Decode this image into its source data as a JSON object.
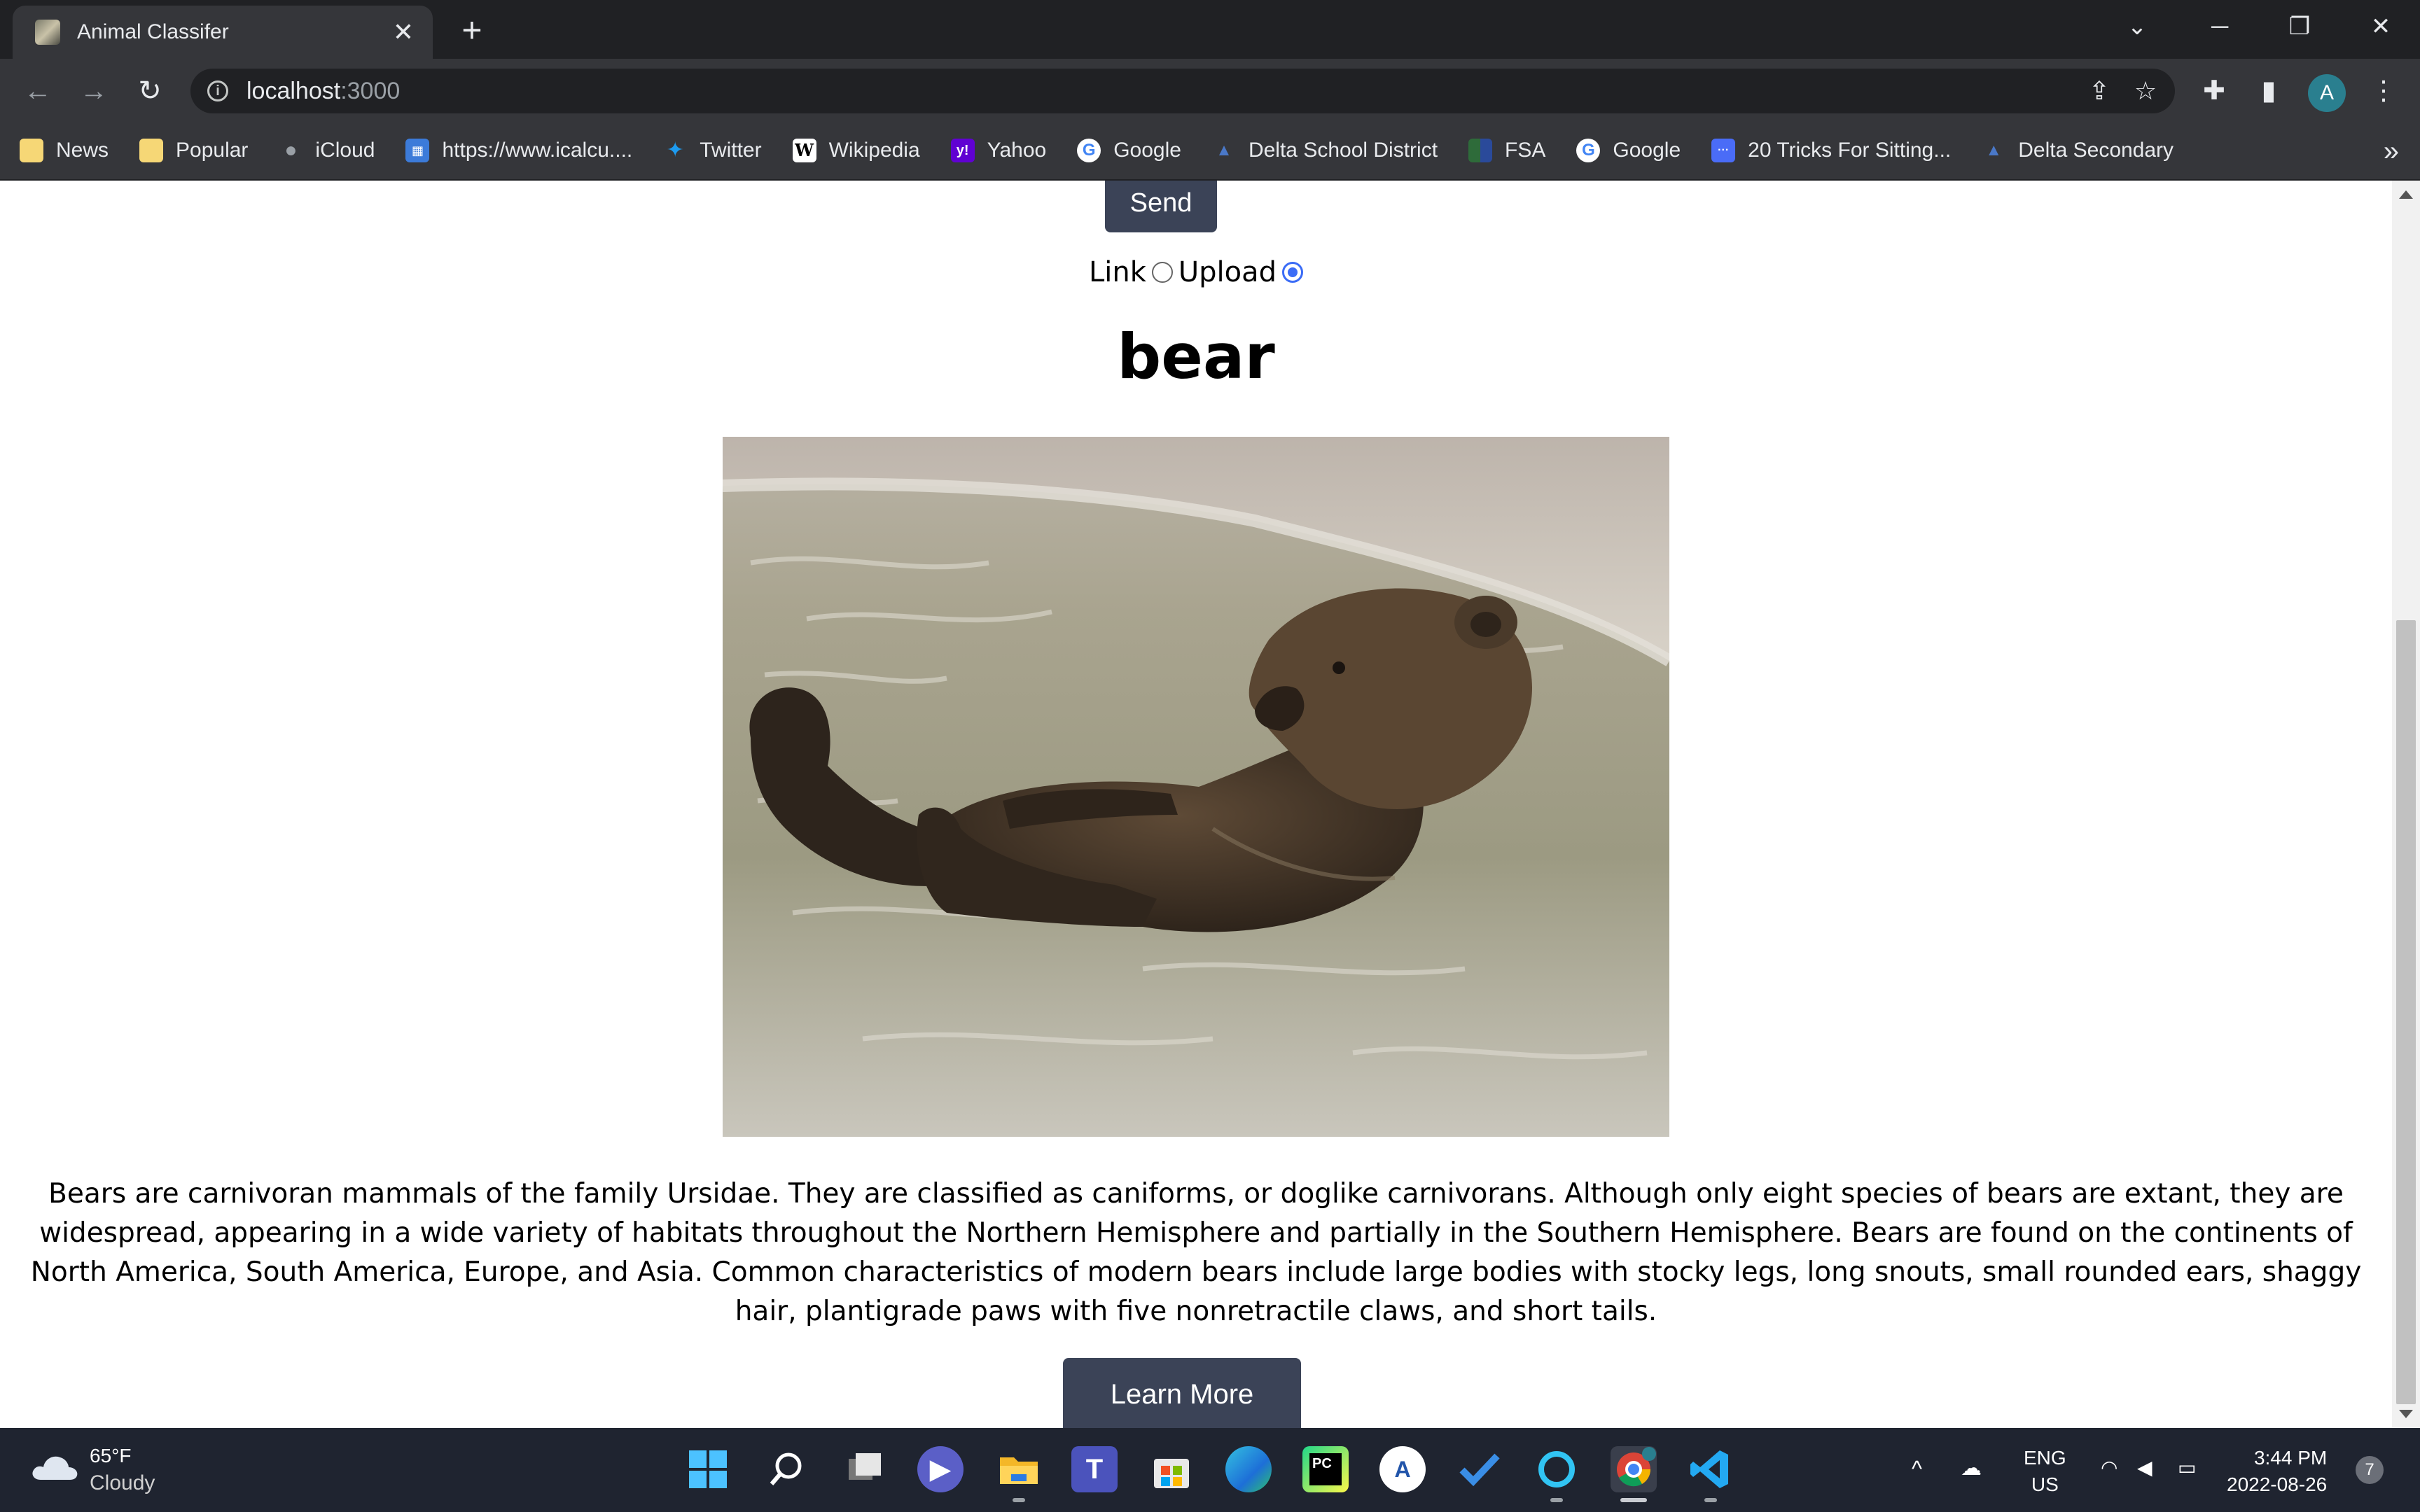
{
  "browser": {
    "tab": {
      "title": "Animal Classifer",
      "close_glyph": "✕"
    },
    "new_tab_glyph": "+",
    "window_controls": {
      "tablist": "⌄",
      "minimize": "─",
      "restore": "❐",
      "close": "✕"
    },
    "nav": {
      "back": "←",
      "forward": "→",
      "reload": "↻"
    },
    "address": {
      "host": "localhost",
      "port": ":3000"
    },
    "omnibox_icons": {
      "share": "⇪",
      "star": "☆"
    },
    "toolbar_icons": {
      "extensions": "✚",
      "side_panel": "▮"
    },
    "profile_initial": "A",
    "bookmarks": [
      {
        "label": "News",
        "icon": "folder-icon",
        "color": "#f6d776"
      },
      {
        "label": "Popular",
        "icon": "folder-icon",
        "color": "#f6d776"
      },
      {
        "label": "iCloud",
        "icon": "apple-icon",
        "color": "#9aa0a6"
      },
      {
        "label": "https://www.icalcu....",
        "icon": "calculator-icon",
        "color": "#3c7bd9"
      },
      {
        "label": "Twitter",
        "icon": "twitter-icon",
        "color": "#1d9bf0"
      },
      {
        "label": "Wikipedia",
        "icon": "wikipedia-icon",
        "color": "#ffffff"
      },
      {
        "label": "Yahoo",
        "icon": "yahoo-icon",
        "color": "#6001d2"
      },
      {
        "label": "Google",
        "icon": "google-icon",
        "color": "#ffffff"
      },
      {
        "label": "Delta School District",
        "icon": "delta-icon",
        "color": "#2a4a8a"
      },
      {
        "label": "FSA",
        "icon": "fsa-icon",
        "color": "#2e6b3a"
      },
      {
        "label": "Google",
        "icon": "google-icon",
        "color": "#ffffff"
      },
      {
        "label": "20 Tricks For Sitting...",
        "icon": "site-icon",
        "color": "#4a6cf7"
      },
      {
        "label": "Delta Secondary",
        "icon": "delta-icon",
        "color": "#2a4a8a"
      }
    ],
    "bookmarks_overflow": "»"
  },
  "page": {
    "send_label": "Send",
    "radio": {
      "link_label": "Link",
      "upload_label": "Upload",
      "selected": "Upload"
    },
    "result_title": "bear",
    "description": "Bears are carnivoran mammals of the family Ursidae. They are classified as caniforms, or doglike carnivorans. Although only eight species of bears are extant, they are widespread, appearing in a wide variety of habitats throughout the Northern Hemisphere and partially in the Southern Hemisphere. Bears are found on the continents of North America, South America, Europe, and Asia. Common characteristics of modern bears include large bodies with stocky legs, long snouts, small rounded ears, shaggy hair, plantigrade paws with five nonretractile claws, and short tails.",
    "learn_more_label": "Learn More",
    "button_color": "#3b4357"
  },
  "taskbar": {
    "weather": {
      "temp": "65°F",
      "condition": "Cloudy"
    },
    "apps": [
      "start-icon",
      "search-icon",
      "task-view-icon",
      "chat-icon",
      "file-explorer-icon",
      "teams-icon",
      "store-icon",
      "edge-icon",
      "pycharm-icon",
      "app-icon",
      "todo-icon",
      "cortana-icon",
      "chrome-icon",
      "vscode-icon"
    ],
    "tray": {
      "chevron": "^",
      "language_line1": "ENG",
      "language_line2": "US"
    },
    "clock": {
      "time": "3:44 PM",
      "date": "2022-08-26"
    },
    "notification_count": "7"
  }
}
